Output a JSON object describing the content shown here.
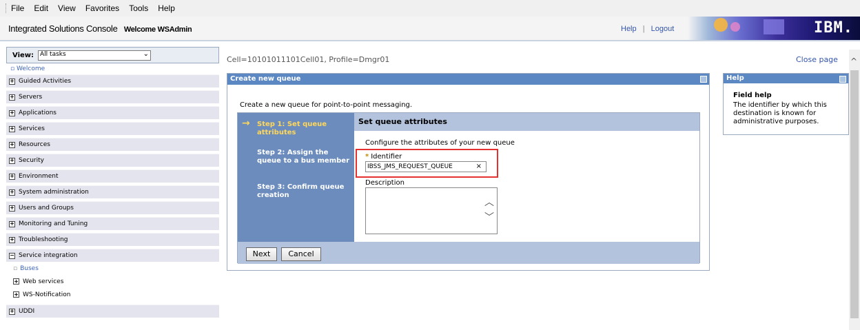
{
  "menu": {
    "items": [
      "File",
      "Edit",
      "View",
      "Favorites",
      "Tools",
      "Help"
    ]
  },
  "header": {
    "title": "Integrated Solutions Console",
    "welcome": "Welcome WSAdmin",
    "help_link": "Help",
    "separator": "|",
    "logout_link": "Logout",
    "logo_text": "IBM."
  },
  "nav": {
    "view_label": "View:",
    "view_value": "All tasks",
    "welcome": "Welcome",
    "items": [
      "Guided Activities",
      "Servers",
      "Applications",
      "Services",
      "Resources",
      "Security",
      "Environment",
      "System administration",
      "Users and Groups",
      "Monitoring and Tuning",
      "Troubleshooting"
    ],
    "expanded_item": "Service integration",
    "sub_items": {
      "buses": "Buses",
      "web_services": "Web services",
      "ws_notification": "WS-Notification"
    },
    "last_item": "UDDI",
    "plus": "+",
    "minus": "−"
  },
  "main": {
    "cell_profile": "Cell=10101011101Cell01, Profile=Dmgr01",
    "close_page": "Close page",
    "panel_title": "Create new queue",
    "intro": "Create a new queue for point-to-point messaging.",
    "steps": [
      "Step 1: Set queue attributes",
      "Step 2: Assign the queue to a bus member",
      "Step 3: Confirm queue creation"
    ],
    "content_title": "Set queue attributes",
    "content_sub": "Configure the attributes of your new queue",
    "identifier_label": "Identifier",
    "identifier_value": "IBSS_JMS_REQUEST_QUEUE",
    "description_label": "Description",
    "description_value": "",
    "next_button": "Next",
    "cancel_button": "Cancel"
  },
  "help": {
    "title": "Help",
    "field_help_title": "Field help",
    "field_help_text": "The identifier by which this destination is known for administrative purposes."
  },
  "colors": {
    "panel_title_bg": "#5b87c2",
    "steps_bg": "#6b8cbc",
    "current_step": "#ffd75a",
    "highlight_border": "#e53030",
    "link": "#3b62b7"
  }
}
